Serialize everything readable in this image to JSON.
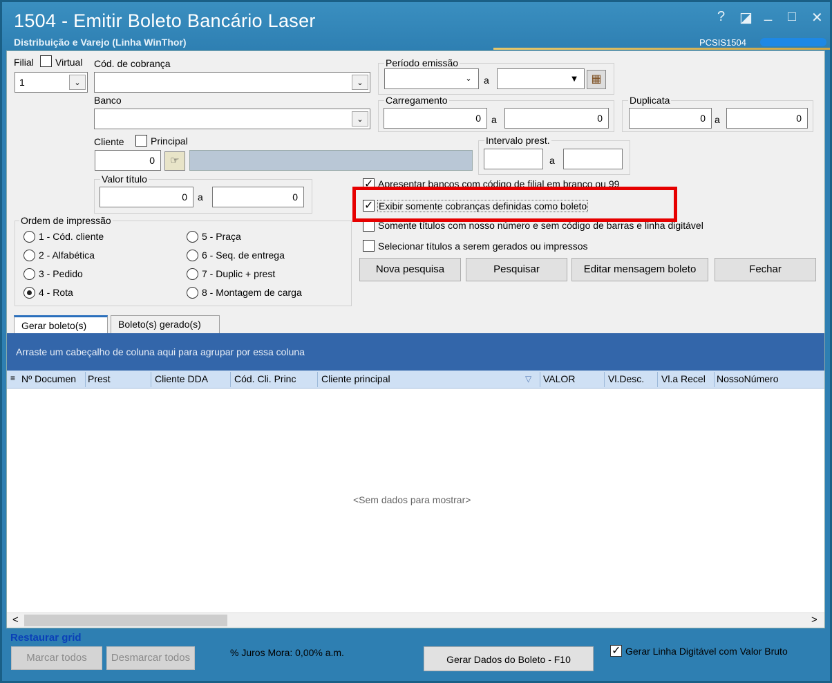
{
  "window": {
    "title": "1504 - Emitir Boleto Bancário Laser",
    "subtitle": "Distribuição e Varejo (Linha WinThor)",
    "program_code": "PCSIS1504",
    "help": "?",
    "restore": "◪",
    "minimize": "_",
    "maximize": "□",
    "close": "✕"
  },
  "filters": {
    "filial_label": "Filial",
    "virtual_label": "Virtual",
    "filial_value": "1",
    "cod_cobranca_label": "Cód. de cobrança",
    "cod_cobranca_value": "",
    "banco_label": "Banco",
    "banco_value": "",
    "periodo_emissao_label": "Período emissão",
    "periodo_a": "a",
    "carregamento_label": "Carregamento",
    "carregamento_from": "0",
    "carregamento_to": "0",
    "carregamento_a": "a",
    "duplicata_label": "Duplicata",
    "duplicata_from": "0",
    "duplicata_to": "0",
    "duplicata_a": "a",
    "cliente_label": "Cliente",
    "principal_label": "Principal",
    "cliente_value": "0",
    "intervalo_prest_label": "Intervalo prest.",
    "intervalo_a": "a",
    "valor_titulo_label": "Valor título",
    "valor_from": "0",
    "valor_to": "0",
    "valor_a": "a"
  },
  "options": {
    "apresentar_bancos": "Apresentar bancos com código de filial em branco ou 99",
    "exibir_somente": "Exibir somente cobranças definidas como boleto",
    "somente_titulos": "Somente títulos com nosso número e sem código de barras e linha digitável",
    "selecionar_titulos": "Selecionar títulos a serem gerados ou impressos"
  },
  "ordem": {
    "title": "Ordem de impressão",
    "items": [
      "1 - Cód. cliente",
      "2 - Alfabética",
      "3 - Pedido",
      "4 - Rota",
      "5 - Praça",
      "6 - Seq. de entrega",
      "7 - Duplic + prest",
      "8 - Montagem de carga"
    ]
  },
  "buttons": {
    "nova_pesquisa": "Nova pesquisa",
    "pesquisar": "Pesquisar",
    "editar_mensagem": "Editar mensagem boleto",
    "fechar": "Fechar",
    "marcar_todos": "Marcar todos",
    "desmarcar_todos": "Desmarcar todos",
    "gerar_dados": "Gerar Dados do Boleto - F10"
  },
  "tabs": [
    "Gerar boleto(s)",
    "Boleto(s) gerado(s)"
  ],
  "grid": {
    "group_hint": "Arraste um cabeçalho de coluna aqui para agrupar por essa coluna",
    "columns": [
      "Nº Documen",
      "Prest",
      "Cliente DDA",
      "Cód. Cli. Princ",
      "Cliente principal",
      "VALOR",
      "Vl.Desc.",
      "Vl.a Recel",
      "NossoNúmero"
    ],
    "empty": "<Sem dados para mostrar>",
    "scroll_left": "<",
    "scroll_right": ">"
  },
  "footer": {
    "restaurar_grid": "Restaurar grid",
    "juros_mora": "% Juros Mora: 0,00% a.m.",
    "gerar_linha": "Gerar Linha Digitável com Valor Bruto"
  }
}
